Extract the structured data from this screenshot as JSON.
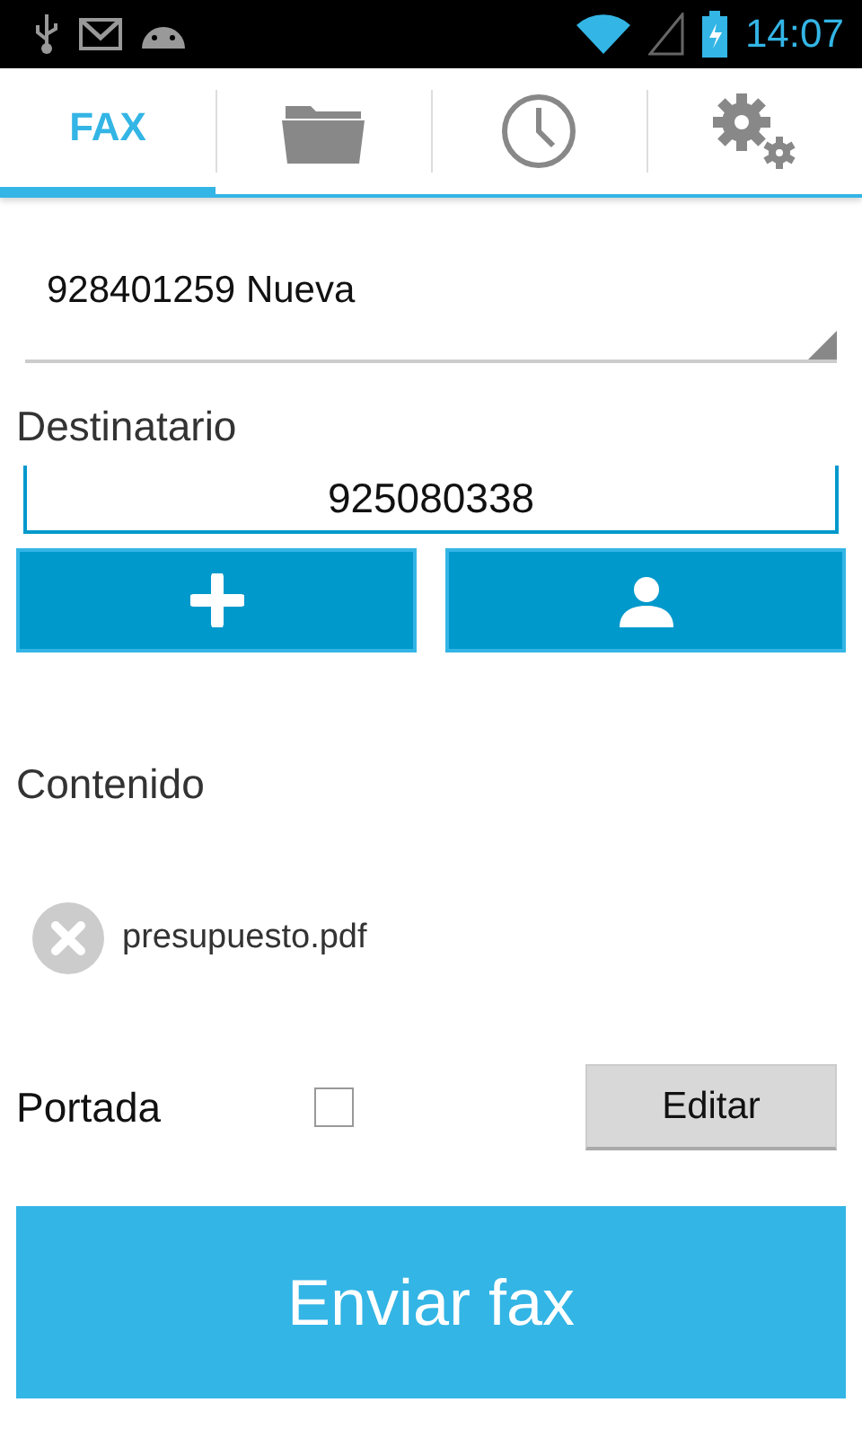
{
  "status_bar": {
    "time": "14:07"
  },
  "tabs": [
    {
      "kind": "text",
      "label": "FAX",
      "selected": true
    },
    {
      "kind": "folder",
      "selected": false
    },
    {
      "kind": "clock",
      "selected": false
    },
    {
      "kind": "gears",
      "selected": false
    }
  ],
  "sender": {
    "value": "928401259 Nueva"
  },
  "recipient": {
    "label": "Destinatario",
    "value": "925080338"
  },
  "content": {
    "label": "Contenido",
    "files": [
      {
        "name": "presupuesto.pdf"
      }
    ]
  },
  "cover": {
    "label": "Portada",
    "checked": false,
    "edit_button": "Editar"
  },
  "send_button": "Enviar fax"
}
